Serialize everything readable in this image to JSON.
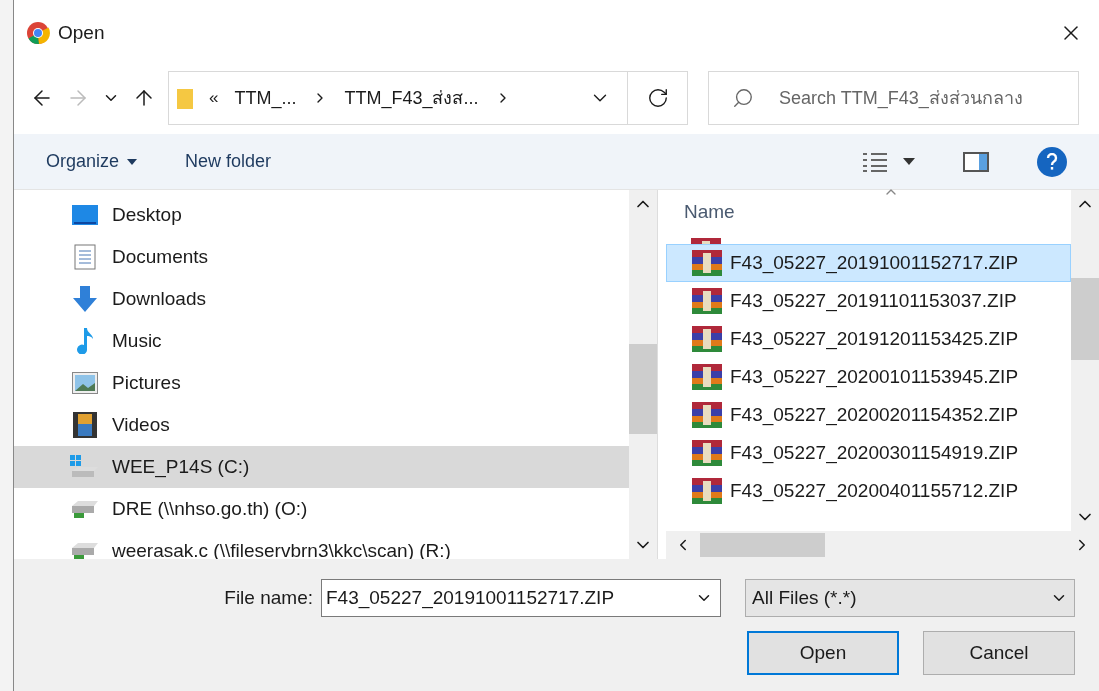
{
  "window": {
    "title": "Open"
  },
  "address_bar": {
    "overflow": "«",
    "crumbs": [
      "TTM_...",
      "TTM_F43_ส่งส..."
    ]
  },
  "search": {
    "placeholder": "Search TTM_F43_ส่งส่วนกลาง"
  },
  "toolbar": {
    "organize": "Organize",
    "new_folder": "New folder"
  },
  "nav_pane": {
    "items": [
      {
        "label": "Desktop",
        "kind": "desktop",
        "selected": false
      },
      {
        "label": "Documents",
        "kind": "documents",
        "selected": false
      },
      {
        "label": "Downloads",
        "kind": "downloads",
        "selected": false
      },
      {
        "label": "Music",
        "kind": "music",
        "selected": false
      },
      {
        "label": "Pictures",
        "kind": "pictures",
        "selected": false
      },
      {
        "label": "Videos",
        "kind": "videos",
        "selected": false
      },
      {
        "label": "WEE_P14S (C:)",
        "kind": "system-drive",
        "selected": true
      },
      {
        "label": "DRE (\\\\nhso.go.th) (O:)",
        "kind": "network-drive",
        "selected": false
      },
      {
        "label": "weerasak.c (\\\\fileservbrn3\\kkc\\scan) (R:)",
        "kind": "network-drive",
        "selected": false
      }
    ]
  },
  "file_list": {
    "column": "Name",
    "files": [
      {
        "name": "F43_05227_20191001152717.ZIP",
        "selected": true
      },
      {
        "name": "F43_05227_20191101153037.ZIP",
        "selected": false
      },
      {
        "name": "F43_05227_20191201153425.ZIP",
        "selected": false
      },
      {
        "name": "F43_05227_20200101153945.ZIP",
        "selected": false
      },
      {
        "name": "F43_05227_20200201154352.ZIP",
        "selected": false
      },
      {
        "name": "F43_05227_20200301154919.ZIP",
        "selected": false
      },
      {
        "name": "F43_05227_20200401155712.ZIP",
        "selected": false
      }
    ]
  },
  "footer": {
    "file_name_label": "File name:",
    "file_name_value": "F43_05227_20191001152717.ZIP",
    "filter": "All Files (*.*)",
    "buttons": [
      {
        "label": "Open",
        "kind": "primary"
      },
      {
        "label": "Cancel",
        "kind": "secondary"
      }
    ]
  }
}
